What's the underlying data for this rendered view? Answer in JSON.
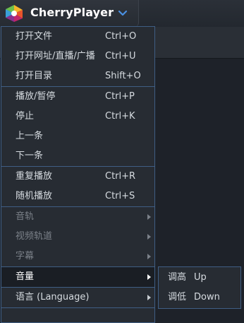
{
  "app": {
    "title": "CherryPlayer"
  },
  "menu": {
    "items": [
      {
        "label": "打开文件",
        "shortcut": "Ctrl+O"
      },
      {
        "label": "打开网址/直播/广播",
        "shortcut": "Ctrl+U"
      },
      {
        "label": "打开目录",
        "shortcut": "Shift+O"
      },
      {
        "label": "播放/暂停",
        "shortcut": "Ctrl+P"
      },
      {
        "label": "停止",
        "shortcut": "Ctrl+K"
      },
      {
        "label": "上一条",
        "shortcut": ""
      },
      {
        "label": "下一条",
        "shortcut": ""
      },
      {
        "label": "重复播放",
        "shortcut": "Ctrl+R"
      },
      {
        "label": "随机播放",
        "shortcut": "Ctrl+S"
      },
      {
        "label": "音轨",
        "shortcut": ""
      },
      {
        "label": "视频轨道",
        "shortcut": ""
      },
      {
        "label": "字幕",
        "shortcut": ""
      },
      {
        "label": "音量",
        "shortcut": ""
      },
      {
        "label": "语言 (Language)",
        "shortcut": ""
      }
    ]
  },
  "submenu": {
    "items": [
      {
        "label": "调高",
        "shortcut": "Up"
      },
      {
        "label": "调低",
        "shortcut": "Down"
      }
    ]
  },
  "colors": {
    "menu_border": "#3f5e84",
    "chevron": "#4a90e2",
    "highlight_bg": "#1a1e24"
  }
}
